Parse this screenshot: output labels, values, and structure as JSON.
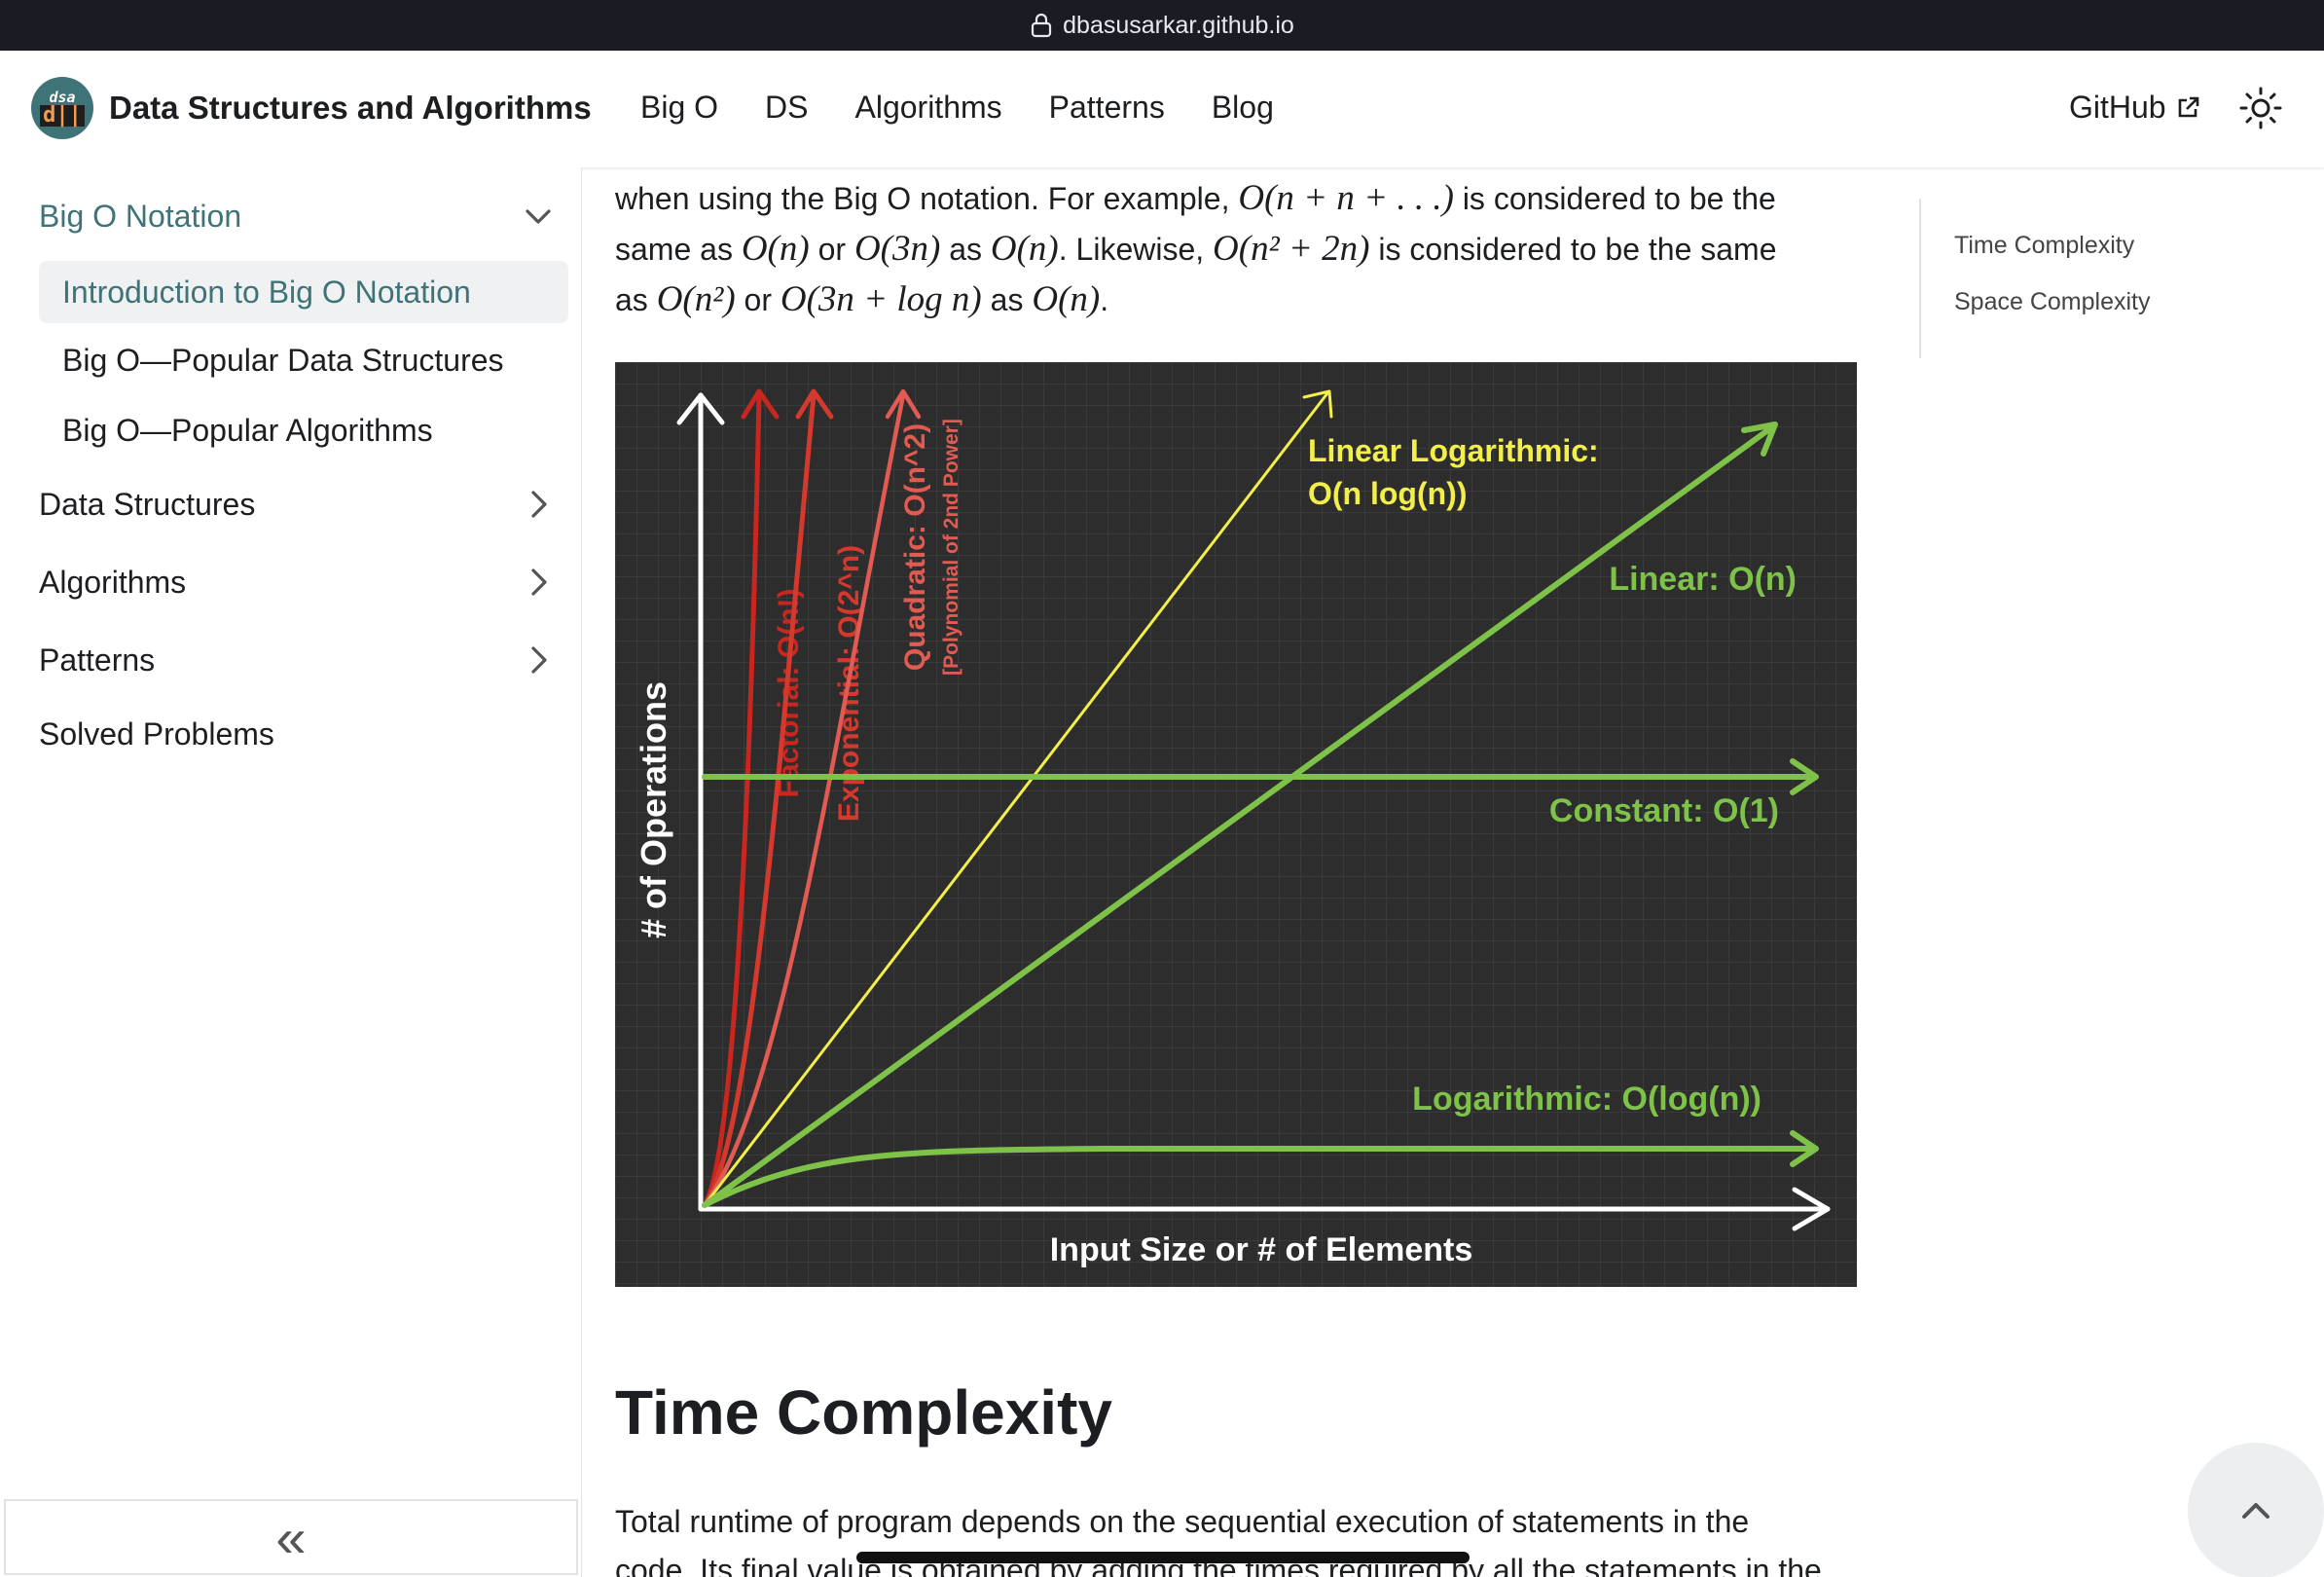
{
  "browser": {
    "url": "dbasusarkar.github.io"
  },
  "navbar": {
    "logo_line1": "dsa",
    "logo_line2": "d||",
    "title": "Data Structures and Algorithms",
    "links": [
      "Big O",
      "DS",
      "Algorithms",
      "Patterns",
      "Blog"
    ],
    "github_label": "GitHub"
  },
  "sidebar": {
    "items": [
      {
        "label": "Big O Notation",
        "state": "expanded"
      },
      {
        "label": "Introduction to Big O Notation",
        "state": "selected"
      },
      {
        "label": "Big O—Popular Data Structures"
      },
      {
        "label": "Big O—Popular Algorithms"
      },
      {
        "label": "Data Structures",
        "state": "collapsed"
      },
      {
        "label": "Algorithms",
        "state": "collapsed"
      },
      {
        "label": "Patterns",
        "state": "collapsed"
      },
      {
        "label": "Solved Problems"
      }
    ],
    "collapse_label": "«"
  },
  "content": {
    "p1_a": "when using the Big O notation. For example, ",
    "p1_m1": "O(n + n + . . .)",
    "p1_b": " is considered to be the",
    "p2_a": "same as ",
    "p2_m1": "O(n)",
    "p2_b": " or ",
    "p2_m2": "O(3n)",
    "p2_c": " as ",
    "p2_m3": "O(n)",
    "p2_d": ". Likewise, ",
    "p2_m4": "O(n² + 2n)",
    "p2_e": " is considered to be the same",
    "p3_a": "as ",
    "p3_m1": "O(n²)",
    "p3_b": " or ",
    "p3_m2": "O(3n + log n)",
    "p3_c": " as ",
    "p3_m3": "O(n)",
    "p3_d": ".",
    "heading": "Time Complexity",
    "para2_l1": "Total runtime of program depends on the sequential execution of statements in the",
    "para2_l2": "code. Its final value is obtained by adding the times required by all the statements in the"
  },
  "toc": {
    "items": [
      "Time Complexity",
      "Space Complexity"
    ]
  },
  "chart_data": {
    "type": "line",
    "title": "",
    "xlabel": "Input Size or # of Elements",
    "ylabel": "# of Operations",
    "grid": true,
    "series": [
      {
        "name": "Factorial: O(n!)",
        "color": "#c9261f"
      },
      {
        "name": "Exponential: O(2^n)",
        "color": "#d5382c"
      },
      {
        "name": "Quadratic: O(n^2)",
        "sublabel": "[Polynomial of 2nd Power]",
        "color": "#e25b52"
      },
      {
        "name": "Linear Logarithmic: O(n log(n))",
        "color": "#f2ef4a"
      },
      {
        "name": "Linear: O(n)",
        "color": "#7fc24a"
      },
      {
        "name": "Constant: O(1)",
        "color": "#7fc24a"
      },
      {
        "name": "Logarithmic: O(log(n))",
        "color": "#7fc24a"
      }
    ]
  }
}
